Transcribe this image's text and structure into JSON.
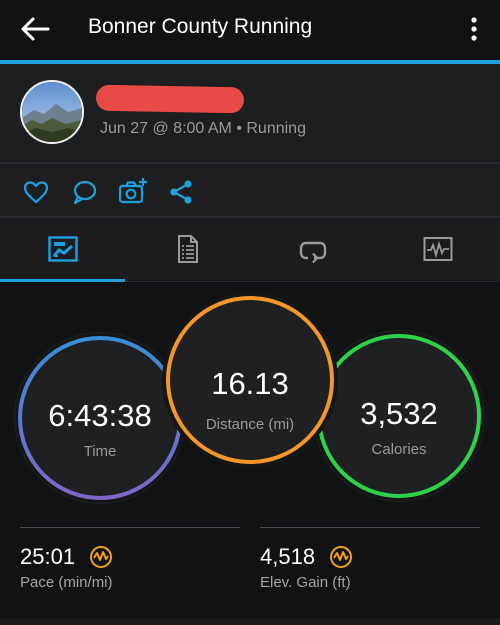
{
  "appbar": {
    "title": "Bonner County Running"
  },
  "activity": {
    "meta": "Jun 27 @ 8:00 AM • Running"
  },
  "actions": {
    "like": "heart-icon",
    "comment": "comment-icon",
    "add_photo": "camera-add-icon",
    "share": "share-icon"
  },
  "tabs": [
    {
      "name": "overview",
      "icon": "chart-icon",
      "active": true
    },
    {
      "name": "details",
      "icon": "document-icon",
      "active": false
    },
    {
      "name": "laps",
      "icon": "repeat-icon",
      "active": false
    },
    {
      "name": "graphs",
      "icon": "activity-graph-icon",
      "active": false
    }
  ],
  "summary": {
    "time": {
      "value": "6:43:38",
      "label": "Time"
    },
    "distance": {
      "value": "16.13",
      "label": "Distance (mi)"
    },
    "calories": {
      "value": "3,532",
      "label": "Calories"
    }
  },
  "stats": {
    "pace": {
      "value": "25:01",
      "label": "Pace (min/mi)"
    },
    "elev_gain": {
      "value": "4,518",
      "label": "Elev. Gain (ft)"
    }
  },
  "colors": {
    "accent": "#1ea0dc",
    "time_ring_top": "#3a8fd8",
    "time_ring_bottom": "#7f65c8",
    "distance_ring": "#f5962a",
    "calories_ring": "#2ed14a",
    "stat_icon": "#f1a01e"
  }
}
